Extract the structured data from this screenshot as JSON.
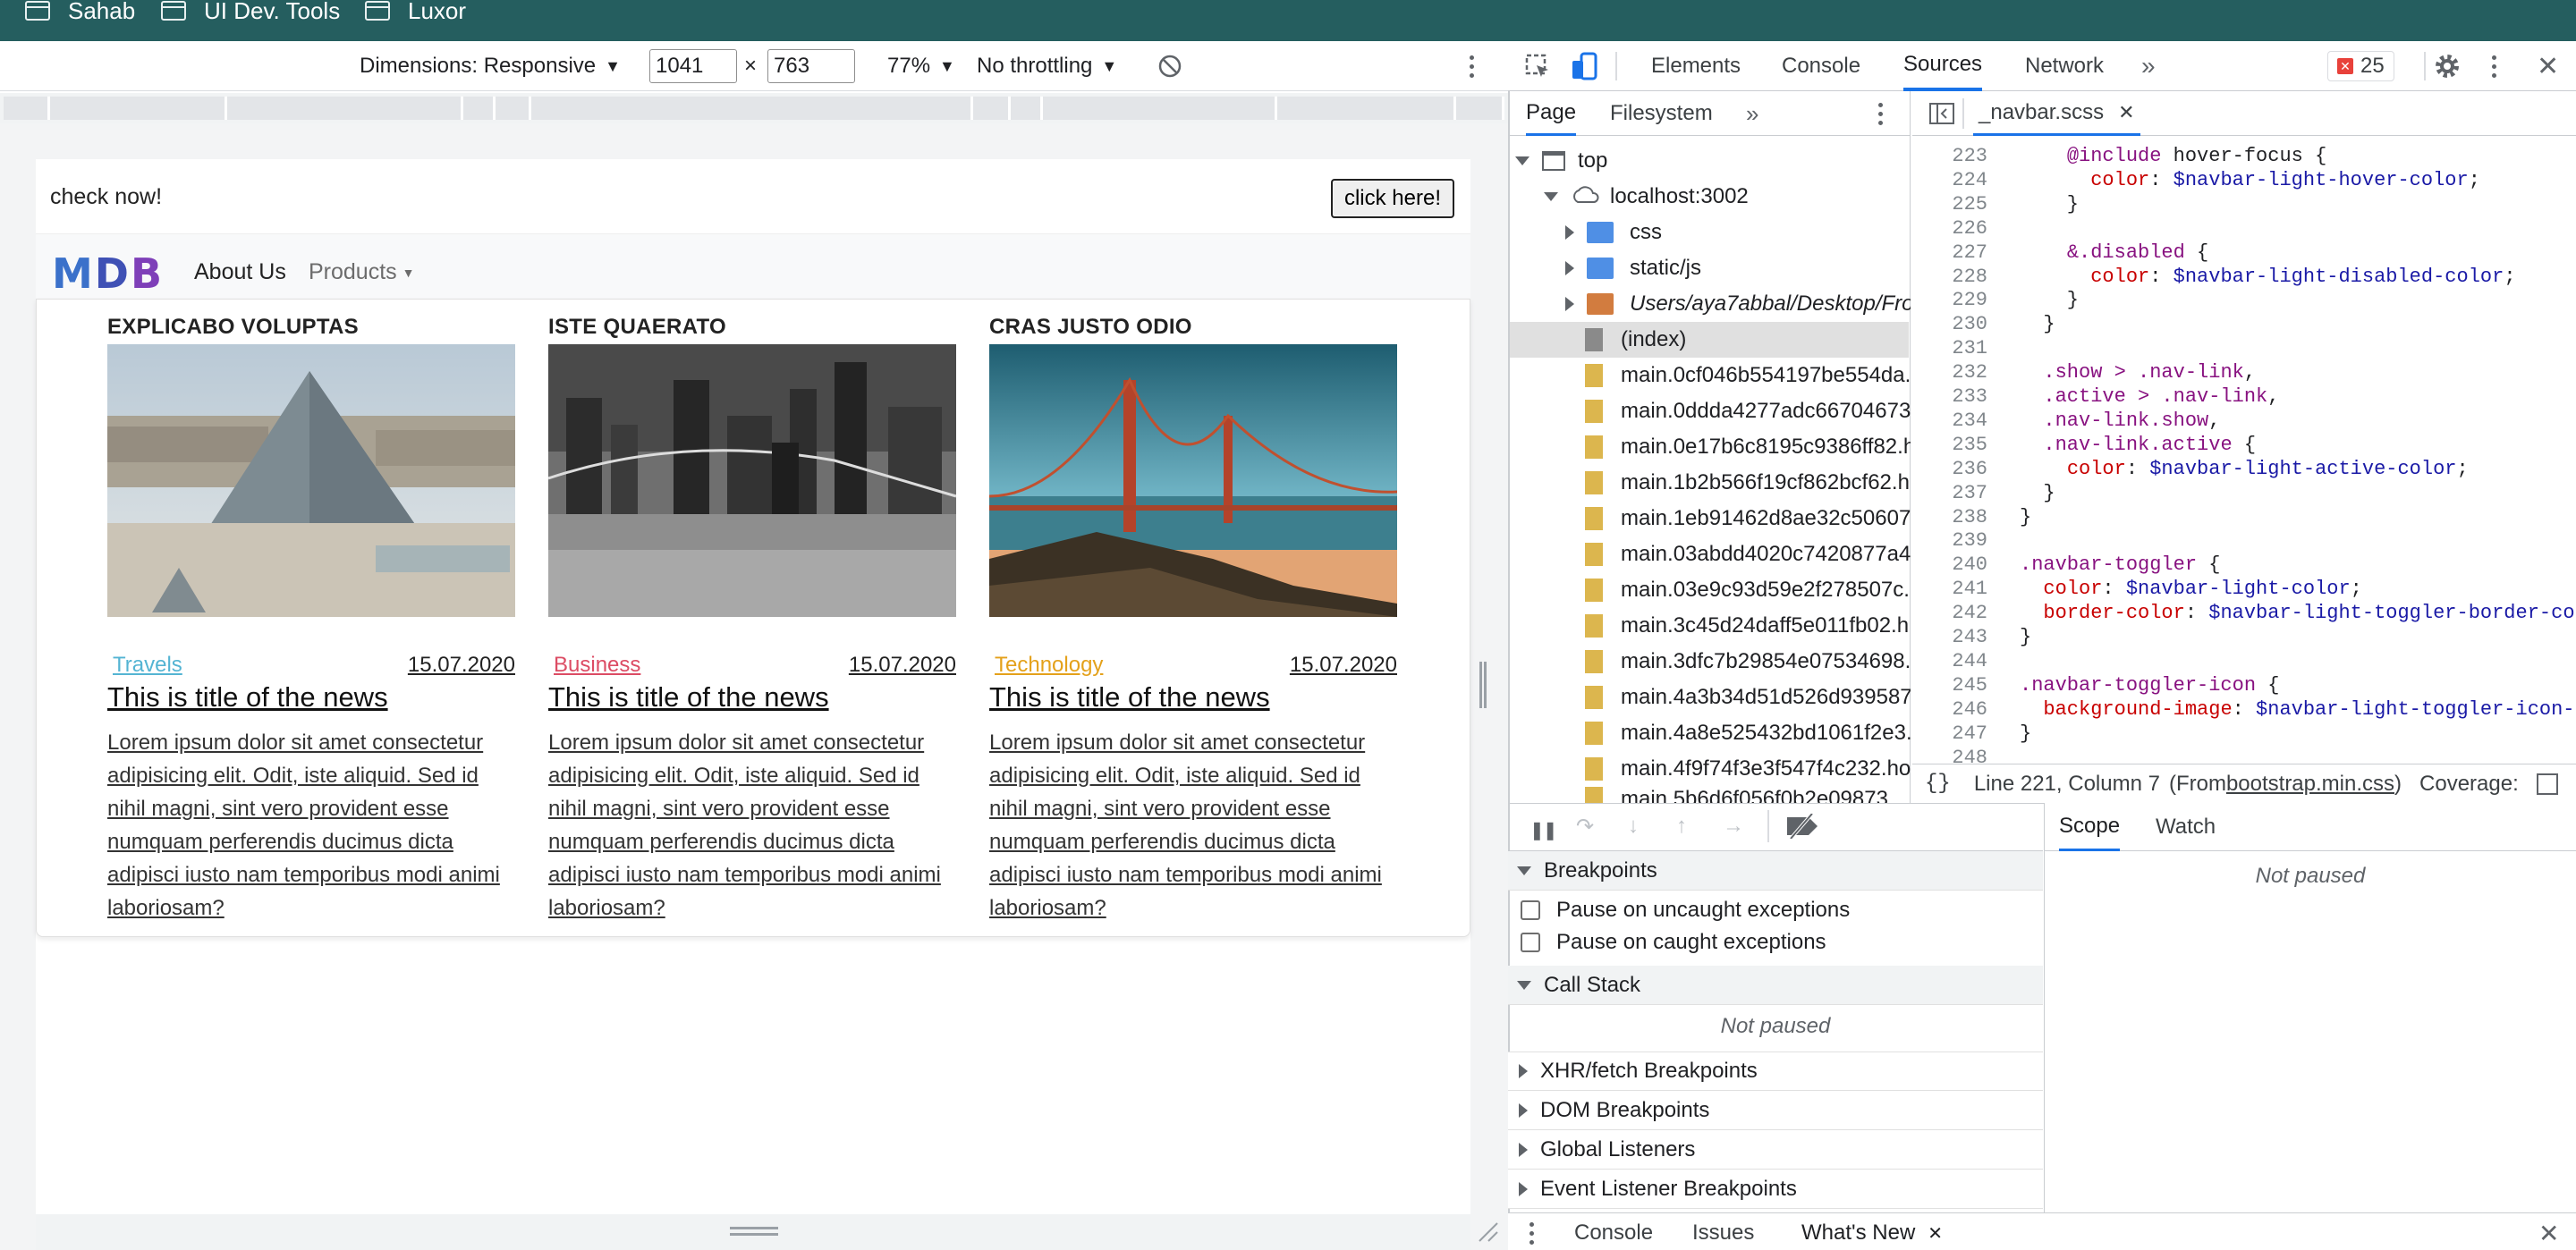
{
  "bookmarks": [
    "Sahab",
    "UI Dev. Tools",
    "Luxor"
  ],
  "device_toolbar": {
    "dimensions_label": "Dimensions: Responsive",
    "width": "1041",
    "height": "763",
    "times": "×",
    "zoom": "77%",
    "throttling": "No throttling"
  },
  "page": {
    "check_text": "check now!",
    "click_button": "click here!",
    "logo": [
      "M",
      "D",
      "B"
    ],
    "nav": [
      "About Us",
      "Products"
    ],
    "columns": [
      {
        "heading": "Explicabo voluptas",
        "category": "Travels",
        "category_color": "#54b4d3",
        "date": "15.07.2020",
        "title": "This is title of the news",
        "body": "Lorem ipsum dolor sit amet consectetur adipisicing elit. Odit, iste aliquid. Sed id nihil magni, sint vero provident esse numquam perferendis ducimus dicta adipisci iusto nam temporibus modi animi laboriosam?"
      },
      {
        "heading": "Iste quaerato",
        "category": "Business",
        "category_color": "#dc4c64",
        "date": "15.07.2020",
        "title": "This is title of the news",
        "body": "Lorem ipsum dolor sit amet consectetur adipisicing elit. Odit, iste aliquid. Sed id nihil magni, sint vero provident esse numquam perferendis ducimus dicta adipisci iusto nam temporibus modi animi laboriosam?"
      },
      {
        "heading": "Cras justo odio",
        "category": "Technology",
        "category_color": "#e4a11b",
        "date": "15.07.2020",
        "title": "This is title of the news",
        "body": "Lorem ipsum dolor sit amet consectetur adipisicing elit. Odit, iste aliquid. Sed id nihil magni, sint vero provident esse numquam perferendis ducimus dicta adipisci iusto nam temporibus modi animi laboriosam?"
      }
    ]
  },
  "devtools": {
    "tabs": [
      "Elements",
      "Console",
      "Sources",
      "Network"
    ],
    "active_tab": "Sources",
    "error_count": "25",
    "navigator_tabs": [
      "Page",
      "Filesystem"
    ],
    "open_file": "_navbar.scss",
    "tree": {
      "top": "top",
      "host": "localhost:3002",
      "folders": [
        "css",
        "static/js",
        "Users/aya7abbal/Desktop/Fron"
      ],
      "index": "(index)",
      "files": [
        "main.0cf046b554197be554da.",
        "main.0ddda4277adc66704673",
        "main.0e17b6c8195c9386ff82.h",
        "main.1b2b566f19cf862bcf62.h",
        "main.1eb91462d8ae32c50607",
        "main.03abdd4020c7420877a4",
        "main.03e9c93d59e2f278507c.",
        "main.3c45d24daff5e011fb02.h",
        "main.3dfc7b29854e07534698.",
        "main.4a3b34d51d526d939587",
        "main.4a8e525432bd1061f2e3.",
        "main.4f9f74f3e3f547f4c232.ho",
        "main.5b6d6f056f0b2e09873"
      ]
    },
    "code_lines": [
      {
        "n": "223",
        "t": "    @include hover-focus {"
      },
      {
        "n": "224",
        "t": "      color: $navbar-light-hover-color;"
      },
      {
        "n": "225",
        "t": "    }"
      },
      {
        "n": "226",
        "t": ""
      },
      {
        "n": "227",
        "t": "    &.disabled {"
      },
      {
        "n": "228",
        "t": "      color: $navbar-light-disabled-color;"
      },
      {
        "n": "229",
        "t": "    }"
      },
      {
        "n": "230",
        "t": "  }"
      },
      {
        "n": "231",
        "t": ""
      },
      {
        "n": "232",
        "t": "  .show > .nav-link,"
      },
      {
        "n": "233",
        "t": "  .active > .nav-link,"
      },
      {
        "n": "234",
        "t": "  .nav-link.show,"
      },
      {
        "n": "235",
        "t": "  .nav-link.active {"
      },
      {
        "n": "236",
        "t": "    color: $navbar-light-active-color;"
      },
      {
        "n": "237",
        "t": "  }"
      },
      {
        "n": "238",
        "t": "}"
      },
      {
        "n": "239",
        "t": ""
      },
      {
        "n": "240",
        "t": ".navbar-toggler {"
      },
      {
        "n": "241",
        "t": "  color: $navbar-light-color;"
      },
      {
        "n": "242",
        "t": "  border-color: $navbar-light-toggler-border-co"
      },
      {
        "n": "243",
        "t": "}"
      },
      {
        "n": "244",
        "t": ""
      },
      {
        "n": "245",
        "t": ".navbar-toggler-icon {"
      },
      {
        "n": "246",
        "t": "  background-image: $navbar-light-toggler-icon-"
      },
      {
        "n": "247",
        "t": "}"
      },
      {
        "n": "248",
        "t": ""
      }
    ],
    "status": {
      "position": "Line 221, Column 7",
      "from_prefix": "(From ",
      "from_file": "bootstrap.min.css",
      "from_suffix": ")",
      "coverage": "Coverage:"
    },
    "debugger": {
      "breakpoints": "Breakpoints",
      "pause_uncaught": "Pause on uncaught exceptions",
      "pause_caught": "Pause on caught exceptions",
      "call_stack": "Call Stack",
      "not_paused": "Not paused",
      "sections": [
        "XHR/fetch Breakpoints",
        "DOM Breakpoints",
        "Global Listeners",
        "Event Listener Breakpoints"
      ],
      "scope_tabs": [
        "Scope",
        "Watch"
      ],
      "scope_not_paused": "Not paused"
    },
    "drawer_tabs": [
      "Console",
      "Issues",
      "What's New"
    ]
  }
}
